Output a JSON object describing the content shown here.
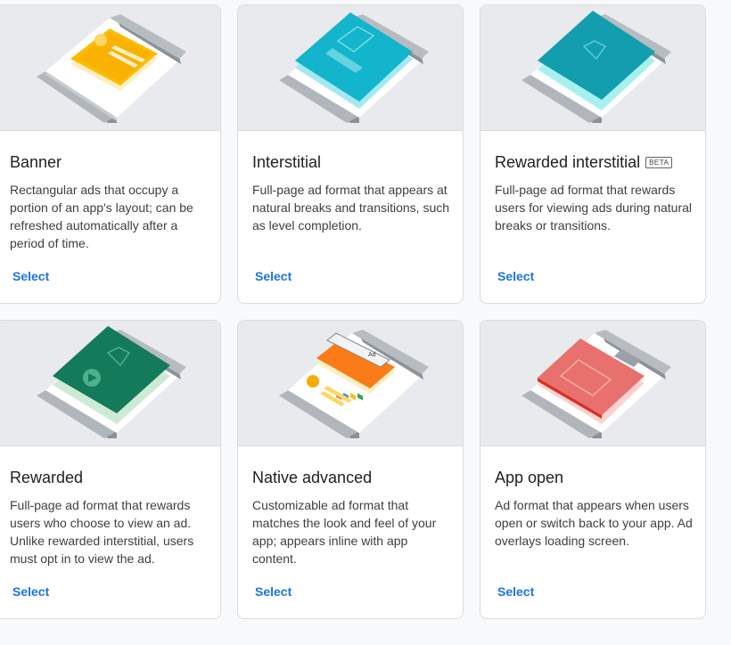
{
  "cards": [
    {
      "title": "Banner",
      "description": "Rectangular ads that occupy a portion of an app's layout; can be refreshed automatically after a period of time.",
      "select_label": "Select",
      "accent": "#fbbc04"
    },
    {
      "title": "Interstitial",
      "description": "Full-page ad format that appears at natural breaks and transitions, such as level completion.",
      "select_label": "Select",
      "accent": "#12b5cb"
    },
    {
      "title": "Rewarded interstitial",
      "badge": "BETA",
      "description": "Full-page ad format that rewards users for viewing ads during natural breaks or transitions.",
      "select_label": "Select",
      "accent": "#129eaf"
    },
    {
      "title": "Rewarded",
      "description": "Full-page ad format that rewards users who choose to view an ad. Unlike rewarded interstitial, users must opt in to view the ad.",
      "select_label": "Select",
      "accent": "#188038"
    },
    {
      "title": "Native advanced",
      "description": "Customizable ad format that matches the look and feel of your app; appears inline with app content.",
      "select_label": "Select",
      "accent": "#fa7b17",
      "ad_label": "Ad"
    },
    {
      "title": "App open",
      "description": "Ad format that appears when users open or switch back to your app. Ad overlays loading screen.",
      "select_label": "Select",
      "accent": "#e8716d"
    }
  ],
  "colors": {
    "link": "#1a73e8",
    "phone_body": "#ffffff",
    "phone_edge": "#9aa0a6",
    "illustration_bg": "#e8eaed"
  }
}
